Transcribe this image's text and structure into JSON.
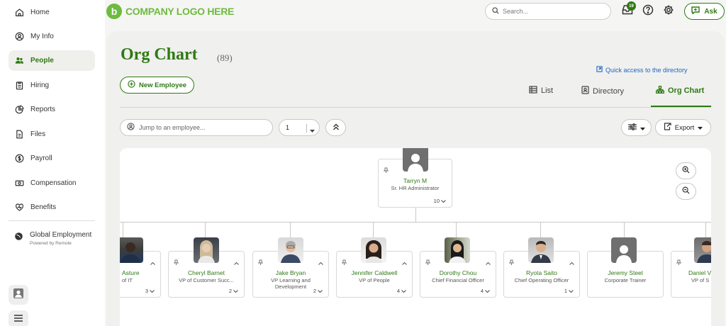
{
  "sidebar": {
    "items": [
      {
        "label": "Home",
        "icon": "home-icon"
      },
      {
        "label": "My Info",
        "icon": "user-circle-icon"
      },
      {
        "label": "People",
        "icon": "people-icon"
      },
      {
        "label": "Hiring",
        "icon": "clipboard-icon"
      },
      {
        "label": "Reports",
        "icon": "pie-chart-icon"
      },
      {
        "label": "Files",
        "icon": "file-icon"
      },
      {
        "label": "Payroll",
        "icon": "dollar-circle-icon"
      },
      {
        "label": "Compensation",
        "icon": "money-icon"
      },
      {
        "label": "Benefits",
        "icon": "heart-icon"
      }
    ],
    "active": "People",
    "global": {
      "title": "Global Employment",
      "subtitle": "Powered by Remote"
    }
  },
  "topbar": {
    "logo_letter": "b",
    "logo_text": "COMPANY LOGO HERE",
    "search_placeholder": "Search...",
    "notification_count": "19",
    "ask_label": "Ask"
  },
  "page": {
    "title": "Org Chart",
    "count": "(89)",
    "quick_link": "Quick access to the directory",
    "new_employee": "New Employee",
    "tabs": [
      {
        "label": "List",
        "active": false
      },
      {
        "label": "Directory",
        "active": false
      },
      {
        "label": "Org Chart",
        "active": true
      }
    ],
    "jump_placeholder": "Jump to an employee...",
    "levels_value": "1",
    "export_label": "Export"
  },
  "org": {
    "root": {
      "name": "Tarryn M",
      "title": "Sr. HR Administrator",
      "reports": "10"
    },
    "children": [
      {
        "name": "Asture",
        "title": "of IT",
        "reports": "3"
      },
      {
        "name": "Cheryl Barnet",
        "title": "VP of Customer Succ...",
        "reports": "2"
      },
      {
        "name": "Jake Bryan",
        "title": "VP Learning and Development",
        "reports": "2"
      },
      {
        "name": "Jennifer Caldwell",
        "title": "VP of People",
        "reports": "4"
      },
      {
        "name": "Dorothy Chou",
        "title": "Chief Financial Officer",
        "reports": "4"
      },
      {
        "name": "Ryota Saito",
        "title": "Chief Operating Officer",
        "reports": "1"
      },
      {
        "name": "Jeremy Steel",
        "title": "Corporate Trainer",
        "reports": ""
      },
      {
        "name": "Daniel V",
        "title": "VP of S",
        "reports": ""
      }
    ]
  },
  "colors": {
    "brand": "#2f7a14",
    "logo": "#6dbb3f",
    "link": "#1f66c0"
  }
}
